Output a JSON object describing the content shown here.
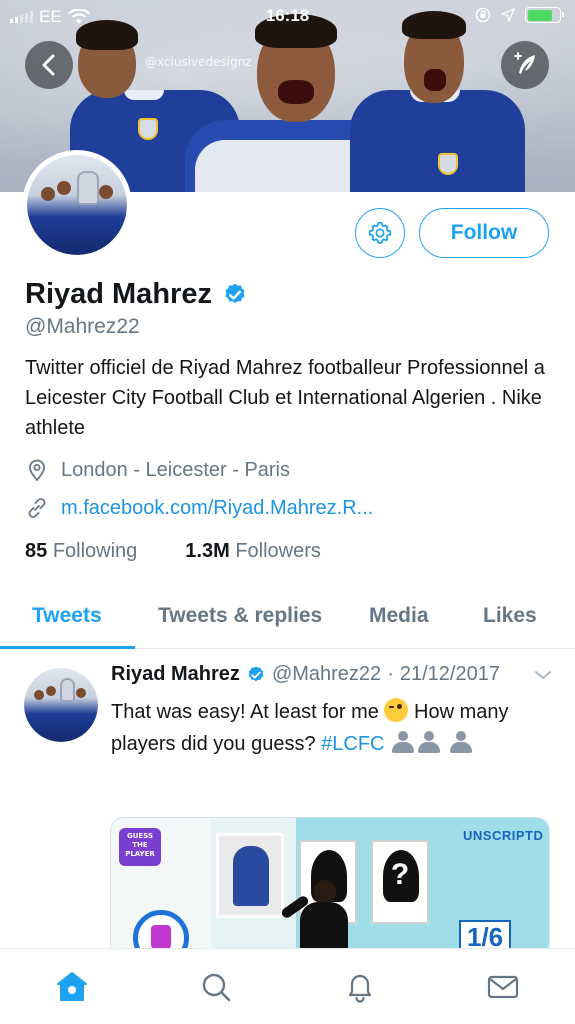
{
  "status_bar": {
    "carrier": "EE",
    "time": "16:18"
  },
  "header": {
    "watermark": "@xclusivedesignz"
  },
  "profile": {
    "name": "Riyad Mahrez",
    "verified": true,
    "handle": "@Mahrez22",
    "bio": "Twitter officiel de Riyad Mahrez footballeur Professionnel a Leicester City Football Club et International Algerien . Nike athlete",
    "location": "London - Leicester - Paris",
    "website": "m.facebook.com/Riyad.Mahrez.R...",
    "following_count": "85",
    "following_label": "Following",
    "followers_count": "1.3M",
    "followers_label": "Followers",
    "follow_button": "Follow"
  },
  "tabs": [
    {
      "label": "Tweets",
      "active": true
    },
    {
      "label": "Tweets & replies",
      "active": false
    },
    {
      "label": "Media",
      "active": false
    },
    {
      "label": "Likes",
      "active": false
    }
  ],
  "tweet": {
    "author": "Riyad Mahrez",
    "handle": "@Mahrez22",
    "separator": "·",
    "date": "21/12/2017",
    "text_part1": "That was easy! At least for me",
    "text_part2": "How many players did you guess?",
    "hashtag": "#LCFC",
    "media": {
      "badge": "GUESS THE PLAYER",
      "brand": "UNSCRIPTD",
      "counter": "1/6"
    }
  },
  "bottom_nav": [
    "home-icon",
    "search-icon",
    "notifications-icon",
    "messages-icon"
  ],
  "colors": {
    "accent": "#1da1f2",
    "link": "#1b95e0",
    "text": "#14171a",
    "secondary": "#657786",
    "divider": "#e1e8ed"
  }
}
